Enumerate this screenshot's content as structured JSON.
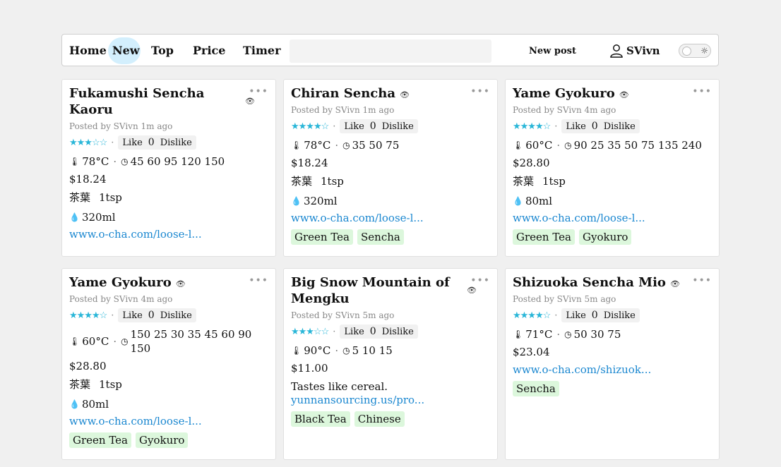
{
  "nav": {
    "items": [
      "Home",
      "New",
      "Top",
      "Price",
      "Timer"
    ],
    "active": "New",
    "search_placeholder": "",
    "new_post": "New post",
    "username": "SVivn",
    "sun_icon": "☼"
  },
  "cards": [
    {
      "title_1": "Fukamushi Sencha",
      "title_2": "Kaoru",
      "posted": "Posted by SVivn 1m ago",
      "stars": "★★★☆☆",
      "like": "Like",
      "count": "0",
      "dislike": "Dislike",
      "temp": "78°C",
      "times": "45 60 95 120 150",
      "price": "$18.24",
      "leaf_label": "茶葉",
      "leaf_amount": "1tsp",
      "water": "320ml",
      "link": "www.o-cha.com/loose-l...",
      "tags": []
    },
    {
      "title": "Chiran Sencha",
      "posted": "Posted by SVivn 1m ago",
      "stars": "★★★★☆",
      "like": "Like",
      "count": "0",
      "dislike": "Dislike",
      "temp": "78°C",
      "times": "35 50 75",
      "price": "$18.24",
      "leaf_label": "茶葉",
      "leaf_amount": "1tsp",
      "water": "320ml",
      "link": "www.o-cha.com/loose-l...",
      "tags": [
        "Green Tea",
        "Sencha"
      ]
    },
    {
      "title": "Yame Gyokuro",
      "posted": "Posted by SVivn 4m ago",
      "stars": "★★★★☆",
      "like": "Like",
      "count": "0",
      "dislike": "Dislike",
      "temp": "60°C",
      "times": "90 25 35 50 75 135 240",
      "price": "$28.80",
      "leaf_label": "茶葉",
      "leaf_amount": "1tsp",
      "water": "80ml",
      "link": "www.o-cha.com/loose-l...",
      "tags": [
        "Green Tea",
        "Gyokuro"
      ]
    },
    {
      "title": "Yame Gyokuro",
      "posted": "Posted by SVivn 4m ago",
      "stars": "★★★★☆",
      "like": "Like",
      "count": "0",
      "dislike": "Dislike",
      "temp": "60°C",
      "times_1": "150 25 30 35 45 60 90",
      "times_2": "150",
      "price": "$28.80",
      "leaf_label": "茶葉",
      "leaf_amount": "1tsp",
      "water": "80ml",
      "link": "www.o-cha.com/loose-l...",
      "tags": [
        "Green Tea",
        "Gyokuro"
      ]
    },
    {
      "title_1": "Big Snow Mountain of",
      "title_2": "Mengku",
      "posted": "Posted by SVivn 5m ago",
      "stars": "★★★☆☆",
      "like": "Like",
      "count": "0",
      "dislike": "Dislike",
      "temp": "90°C",
      "times": "5 10 15",
      "price": "$11.00",
      "note": "Tastes like cereal.",
      "link": "yunnansourcing.us/pro...",
      "tags": [
        "Black Tea",
        "Chinese"
      ]
    },
    {
      "title": "Shizuoka Sencha Mio",
      "posted": "Posted by SVivn 5m ago",
      "stars": "★★★★☆",
      "like": "Like",
      "count": "0",
      "dislike": "Dislike",
      "temp": "71°C",
      "times": "50 30 75",
      "price": "$23.04",
      "link": "www.o-cha.com/shizuok...",
      "tags": [
        "Sencha"
      ]
    }
  ],
  "colors": {
    "star": "#29b6d8",
    "link": "#1a87d0",
    "tag_bg": "#dcf7dc",
    "active_nav": "#d3effd"
  }
}
